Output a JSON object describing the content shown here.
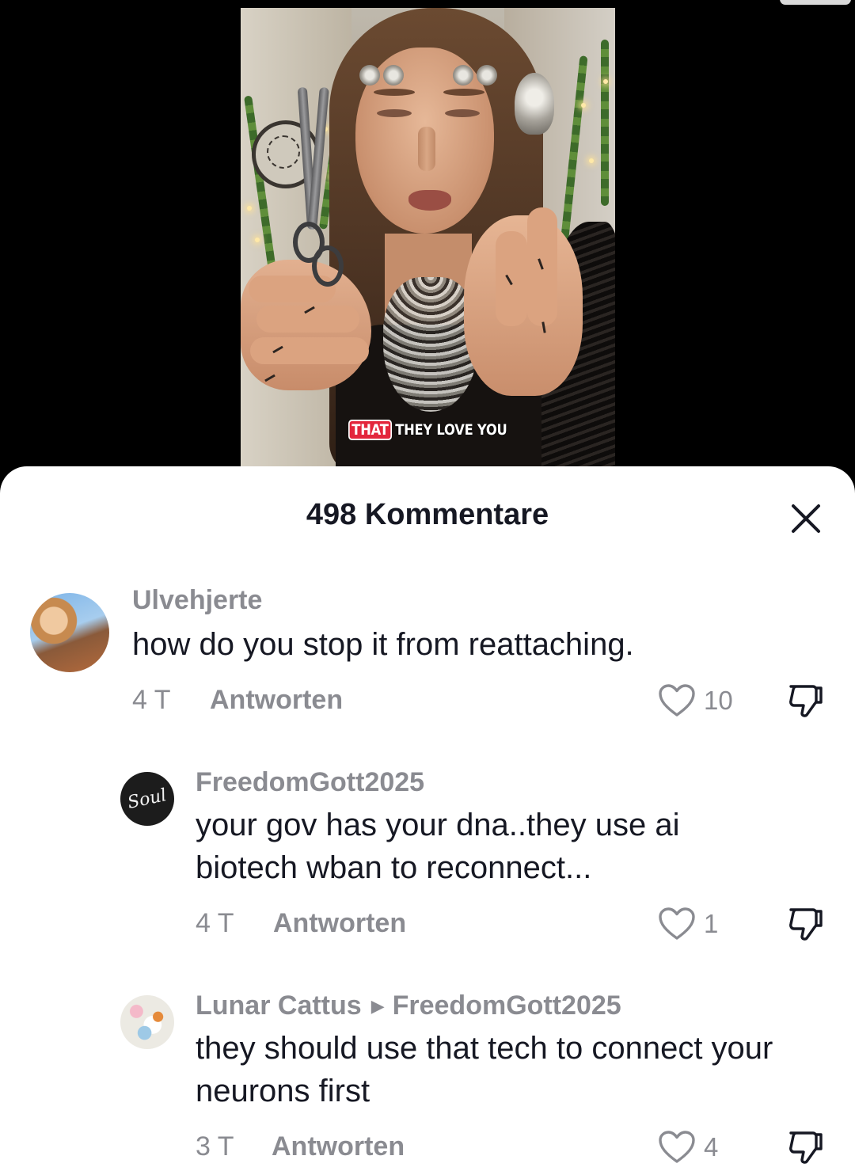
{
  "video": {
    "caption_highlight": "THAT",
    "caption_rest": "THEY LOVE YOU"
  },
  "comments_sheet": {
    "title": "498 Kommentare"
  },
  "comments": [
    {
      "username": "Ulvehjerte",
      "text": "how do you stop it from reattaching.",
      "age": "4 T",
      "reply_label": "Antworten",
      "likes": "10"
    },
    {
      "username": "FreedomGott2025",
      "text": "your gov has your dna..they use ai biotech wban to reconnect...",
      "age": "4 T",
      "reply_label": "Antworten",
      "likes": "1"
    },
    {
      "username": "Lunar Cattus",
      "reply_to": "FreedomGott2025",
      "text": "they should use that tech to connect your neurons first",
      "age": "3 T",
      "reply_label": "Antworten",
      "likes": "4"
    }
  ],
  "avatar_2_text": "Soul",
  "colors": {
    "muted_text": "#8a8b91",
    "main_text": "#161823",
    "caption_highlight": "#e3263c"
  }
}
